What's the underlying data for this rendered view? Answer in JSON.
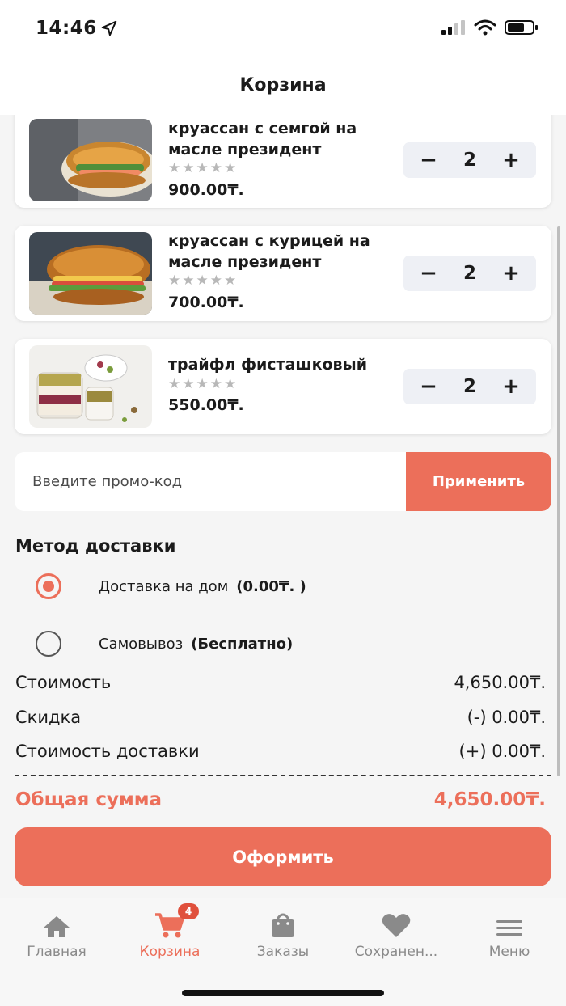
{
  "status": {
    "time": "14:46"
  },
  "header": {
    "title": "Корзина"
  },
  "cart": {
    "items": [
      {
        "name": "круассан с семгой на масле президент",
        "stars": "★★★★★",
        "price": "900.00₸.",
        "qty": "2"
      },
      {
        "name": "круассан с курицей на масле президент",
        "stars": "★★★★★",
        "price": "700.00₸.",
        "qty": "2"
      },
      {
        "name": "трайфл фисташковый",
        "stars": "★★★★★",
        "price": "550.00₸.",
        "qty": "2"
      }
    ],
    "minus": "−",
    "plus": "+"
  },
  "promo": {
    "placeholder": "Введите промо-код",
    "apply_label": "Применить"
  },
  "delivery": {
    "title": "Метод доставки",
    "options": [
      {
        "label": "Доставка на дом",
        "extra": "(0.00₸. )",
        "selected": true
      },
      {
        "label": "Самовывоз",
        "extra": "(Бесплатно)",
        "selected": false
      }
    ]
  },
  "summary": {
    "cost_label": "Стоимость",
    "cost_value": "4,650.00₸.",
    "discount_label": "Скидка",
    "discount_value": "(-) 0.00₸.",
    "delivery_label": "Стоимость доставки",
    "delivery_value": "(+) 0.00₸.",
    "total_label": "Общая сумма",
    "total_value": "4,650.00₸."
  },
  "checkout": {
    "label": "Оформить"
  },
  "tabbar": {
    "tabs": [
      {
        "label": "Главная",
        "icon": "home-icon"
      },
      {
        "label": "Корзина",
        "icon": "cart-icon",
        "badge": "4",
        "active": true
      },
      {
        "label": "Заказы",
        "icon": "bag-icon"
      },
      {
        "label": "Сохранен...",
        "icon": "heart-icon"
      },
      {
        "label": "Меню",
        "icon": "menu-icon"
      }
    ]
  },
  "colors": {
    "accent": "#ec6f5a",
    "badge": "#e0503c",
    "stepper_bg": "#eef0f5"
  }
}
